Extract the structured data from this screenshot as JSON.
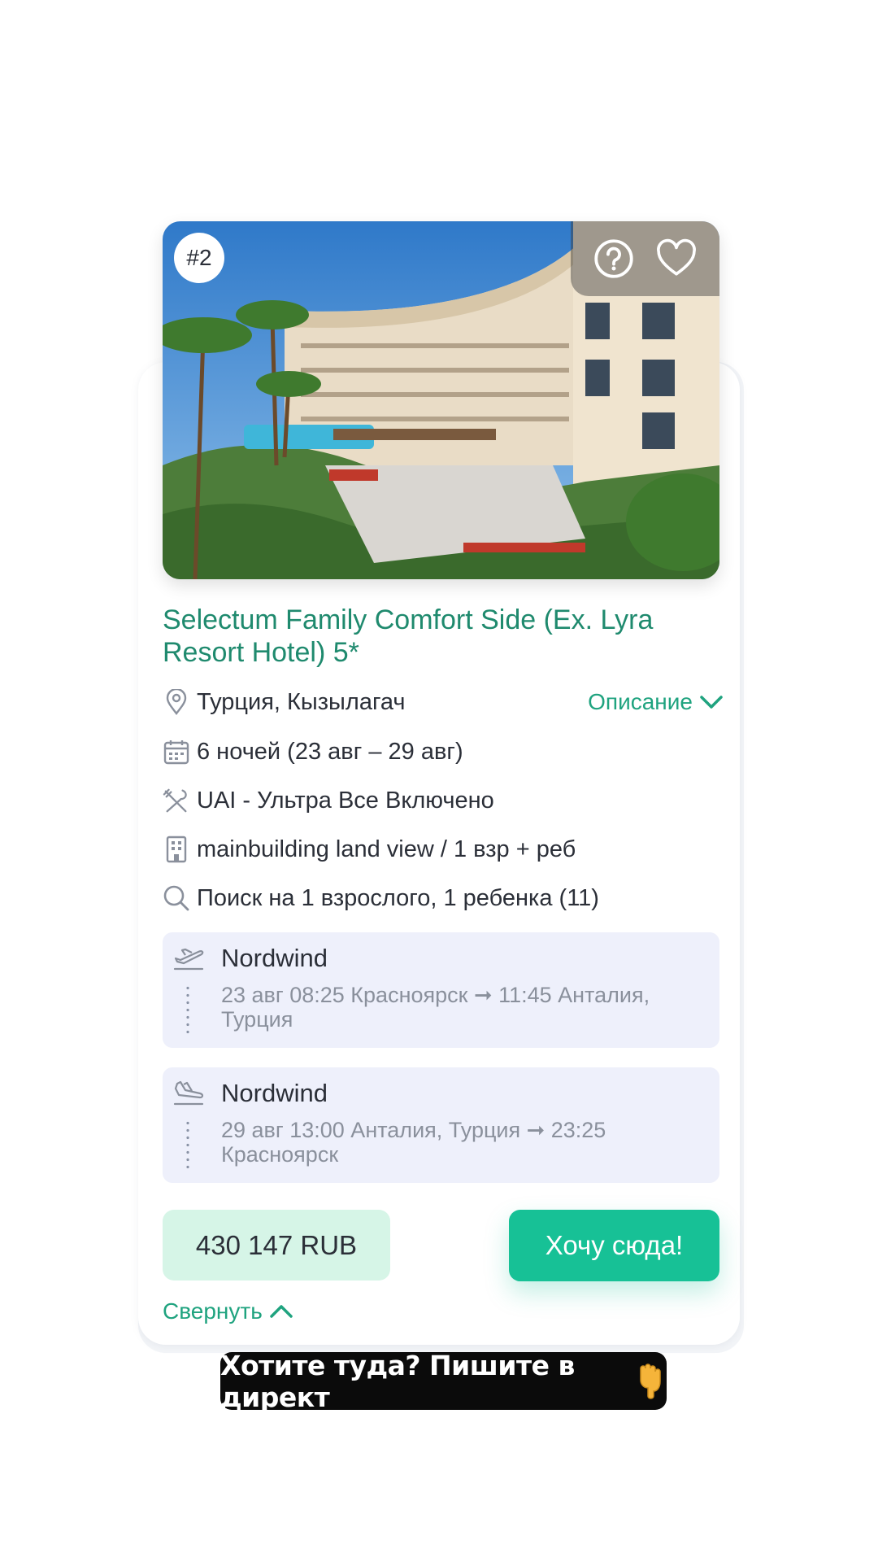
{
  "hotel": {
    "rank": "#2",
    "title": "Selectum Family Comfort Side (Ex. Lyra Resort Hotel) 5*",
    "location": "Турция, Кызылагач",
    "description_link": "Описание",
    "nights": "6 ночей (23 авг – 29 авг)",
    "meal": "UAI - Ультра Все Включено",
    "room": "mainbuilding land view / 1 взр + реб",
    "search": "Поиск на 1 взрослого, 1 ребенка (11)"
  },
  "flights": [
    {
      "airline": "Nordwind",
      "route": "23 авг 08:25 Красноярск ➞ 11:45 Анталия, Турция",
      "icon": "plane-departure-icon"
    },
    {
      "airline": "Nordwind",
      "route": "29 авг 13:00 Анталия, Турция ➞ 23:25 Красноярск",
      "icon": "plane-arrival-icon"
    }
  ],
  "price": "430 147 RUB",
  "cta_label": "Хочу сюда!",
  "collapse_label": "Свернуть",
  "caption": "Хотите туда? Пишите в директ",
  "colors": {
    "accent": "#17c196",
    "title_green": "#1f8a6e",
    "flight_bg": "#eef0fb",
    "price_bg": "#d6f5e7"
  }
}
